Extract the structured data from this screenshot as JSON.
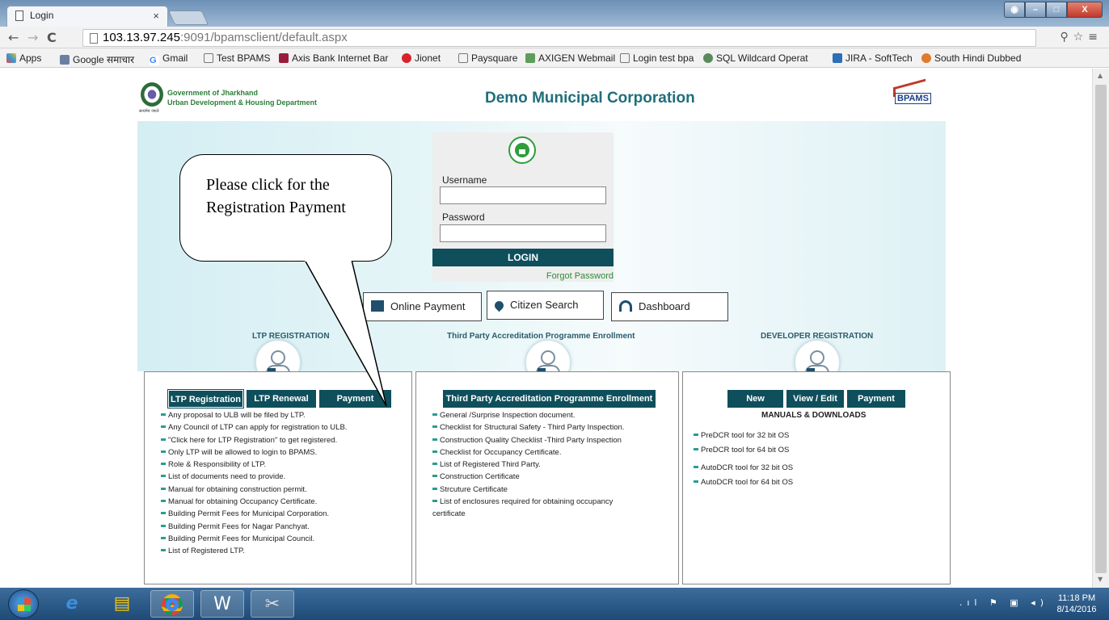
{
  "browser": {
    "tab_title": "Login",
    "tab_close": "×",
    "url_host": "103.13.97.245",
    "url_rest": ":9091/bpamsclient/default.aspx",
    "bookmarks": [
      "Apps",
      "Google समाचार",
      "Gmail",
      "Test BPAMS",
      "Axis Bank Internet Bar",
      "Jionet",
      "Paysquare",
      "AXIGEN Webmail",
      "Login test bpa",
      "SQL Wildcard Operat",
      "JIRA - SoftTech",
      "South Hindi Dubbed"
    ]
  },
  "header": {
    "gov_line1": "Government of Jharkhand",
    "gov_line2": "Urban Development & Housing Department",
    "motto": "सत्यमेव जयते",
    "title": "Demo Municipal Corporation",
    "logo_text": "BPAMS"
  },
  "login": {
    "username_label": "Username",
    "password_label": "Password",
    "login_button": "LOGIN",
    "forgot": "Forgot Password"
  },
  "quick": {
    "online_payment": "Online Payment",
    "citizen_search": "Citizen Search",
    "dashboard": "Dashboard"
  },
  "callout": "Please click for the Registration Payment",
  "ltp": {
    "title": "LTP REGISTRATION",
    "btn_registration": "LTP Registration",
    "btn_renewal": "LTP Renewal",
    "btn_payment": "Payment",
    "items": [
      "Any proposal to ULB will be filed by LTP.",
      "Any Council of LTP can apply for registration to ULB.",
      "\"Click here for LTP Registration\" to get registered.",
      "Only LTP will be allowed to login to BPAMS.",
      "Role & Responsibility of LTP.",
      "List of documents need to provide.",
      "Manual for obtaining construction permit.",
      "Manual for obtaining Occupancy Certificate.",
      "Building Permit Fees for Municipal Corporation.",
      "Building Permit Fees for Nagar Panchyat.",
      "Building Permit Fees for Municipal Council.",
      "List of Registered LTP."
    ]
  },
  "tpa": {
    "title": "Third Party Accreditation Programme Enrollment",
    "btn": "Third Party Accreditation Programme Enrollment",
    "items": [
      "General /Surprise Inspection document.",
      "Checklist for Structural Safety - Third Party Inspection.",
      "Construction Quality Checklist -Third Party Inspection",
      "Checklist for Occupancy Certificate.",
      "List of Registered Third Party.",
      "Construction Certificate",
      "Strcuture Certificate",
      "List of enclosures required for obtaining occupancy",
      "certificate"
    ]
  },
  "dev": {
    "title": "DEVELOPER REGISTRATION",
    "btn_new": "New",
    "btn_view": "View / Edit",
    "btn_payment": "Payment",
    "manuals": "MANUALS & DOWNLOADS",
    "items": [
      "PreDCR tool for 32 bit OS",
      "PreDCR tool for 64 bit OS",
      "AutoDCR tool for 32 bit OS",
      "AutoDCR tool for 64 bit OS"
    ]
  },
  "taskbar": {
    "time": "11:18 PM",
    "date": "8/14/2016"
  }
}
